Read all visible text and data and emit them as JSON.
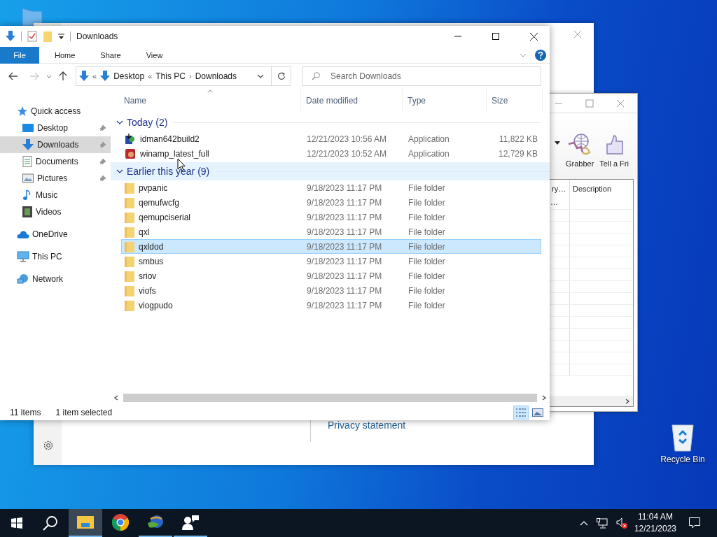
{
  "desktop": {
    "recycle_bin": {
      "label": "Recycle Bin"
    }
  },
  "settings_window": {
    "link": "Privacy statement"
  },
  "idm_window": {
    "toolbar": [
      {
        "label": "Grabber",
        "kind": "grabber"
      },
      {
        "label": "Tell a Fri",
        "kind": "thumb"
      }
    ],
    "columns": [
      "ry…",
      "Description"
    ],
    "rows": [
      {
        "column_1": "…"
      }
    ]
  },
  "explorer": {
    "title": "Downloads",
    "ribbon_tabs": [
      {
        "label": "File",
        "kind": "file"
      },
      {
        "label": "Home",
        "kind": "tab"
      },
      {
        "label": "Share",
        "kind": "tab"
      },
      {
        "label": "View",
        "kind": "tab"
      }
    ],
    "address": {
      "crumbs": [
        {
          "separator": "«",
          "label": "Desktop"
        },
        {
          "separator": "«",
          "label": "This PC"
        },
        {
          "separator": "›",
          "label": "Downloads"
        }
      ]
    },
    "search": {
      "placeholder": "Search Downloads"
    },
    "navigation": [
      {
        "label": "Quick access",
        "kind": "star",
        "selected": false,
        "children": [
          {
            "label": "Desktop",
            "kind": "desktop",
            "selected": false,
            "pinned": true
          },
          {
            "label": "Downloads",
            "kind": "download",
            "selected": true,
            "pinned": true
          },
          {
            "label": "Documents",
            "kind": "document",
            "selected": false,
            "pinned": true
          },
          {
            "label": "Pictures",
            "kind": "picture",
            "selected": false,
            "pinned": true
          },
          {
            "label": "Music",
            "kind": "music",
            "selected": false,
            "pinned": false
          },
          {
            "label": "Videos",
            "kind": "video",
            "selected": false,
            "pinned": false
          }
        ]
      },
      {
        "label": "OneDrive",
        "kind": "cloud",
        "selected": false
      },
      {
        "label": "This PC",
        "kind": "pc",
        "selected": false
      },
      {
        "label": "Network",
        "kind": "network",
        "selected": false
      }
    ],
    "columns": [
      "Name",
      "Date modified",
      "Type",
      "Size"
    ],
    "groups": [
      {
        "title": "Today (2)",
        "expanded": true,
        "hovered": false,
        "rows": [
          {
            "name": "idman642build2",
            "kind": "installer",
            "date": "12/21/2023 10:56 AM",
            "type": "Application",
            "size": "11,822 KB",
            "selected": false
          },
          {
            "name": "winamp_latest_full",
            "kind": "media-app",
            "date": "12/21/2023 10:52 AM",
            "type": "Application",
            "size": "12,729 KB",
            "selected": false
          }
        ]
      },
      {
        "title": "Earlier this year (9)",
        "expanded": true,
        "hovered": true,
        "rows": [
          {
            "name": "pvpanic",
            "kind": "folder",
            "date": "9/18/2023 11:17 PM",
            "type": "File folder",
            "selected": false
          },
          {
            "name": "qemufwcfg",
            "kind": "folder",
            "date": "9/18/2023 11:17 PM",
            "type": "File folder",
            "selected": false
          },
          {
            "name": "qemupciserial",
            "kind": "folder",
            "date": "9/18/2023 11:17 PM",
            "type": "File folder",
            "selected": false
          },
          {
            "name": "qxl",
            "kind": "folder",
            "date": "9/18/2023 11:17 PM",
            "type": "File folder",
            "selected": false
          },
          {
            "name": "qxldod",
            "kind": "folder",
            "date": "9/18/2023 11:17 PM",
            "type": "File folder",
            "selected": true
          },
          {
            "name": "smbus",
            "kind": "folder",
            "date": "9/18/2023 11:17 PM",
            "type": "File folder",
            "selected": false
          },
          {
            "name": "sriov",
            "kind": "folder",
            "date": "9/18/2023 11:17 PM",
            "type": "File folder",
            "selected": false
          },
          {
            "name": "viofs",
            "kind": "folder",
            "date": "9/18/2023 11:17 PM",
            "type": "File folder",
            "selected": false
          },
          {
            "name": "viogpudo",
            "kind": "folder",
            "date": "9/18/2023 11:17 PM",
            "type": "File folder",
            "selected": false
          }
        ]
      }
    ],
    "status": {
      "count": "11 items",
      "selection": "1 item selected"
    },
    "views": [
      {
        "kind": "details",
        "selected": true
      },
      {
        "kind": "thumbnails",
        "selected": false
      }
    ]
  },
  "taskbar": {
    "apps": [
      {
        "kind": "explorer",
        "selected": true,
        "running": true
      },
      {
        "kind": "chrome",
        "selected": false,
        "running": false
      },
      {
        "kind": "idm",
        "selected": false,
        "running": true
      },
      {
        "kind": "chat",
        "selected": false,
        "running": true
      }
    ],
    "clock": {
      "time": "11:04 AM",
      "date": "12/21/2023"
    }
  }
}
